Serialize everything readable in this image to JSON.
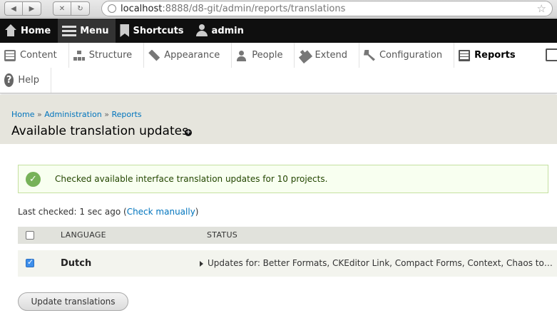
{
  "browser": {
    "url_host": "localhost",
    "url_path": ":8888/d8-git/admin/reports/translations"
  },
  "toolbar": {
    "home": "Home",
    "menu": "Menu",
    "shortcuts": "Shortcuts",
    "user": "admin"
  },
  "tray": {
    "items": [
      {
        "label": "Content",
        "icon": "content-icon"
      },
      {
        "label": "Structure",
        "icon": "structure-icon"
      },
      {
        "label": "Appearance",
        "icon": "appearance-icon"
      },
      {
        "label": "People",
        "icon": "people-icon"
      },
      {
        "label": "Extend",
        "icon": "extend-icon"
      },
      {
        "label": "Configuration",
        "icon": "config-icon"
      },
      {
        "label": "Reports",
        "icon": "reports-icon"
      }
    ],
    "help": "Help"
  },
  "breadcrumb": {
    "home": "Home",
    "sep": "»",
    "administration": "Administration",
    "reports": "Reports"
  },
  "page_title": "Available translation updates",
  "status_message": "Checked available interface translation updates for 10 projects.",
  "last_checked": {
    "prefix": "Last checked: 1 sec ago (",
    "link": "Check manually",
    "suffix": ")"
  },
  "table": {
    "headers": {
      "language": "LANGUAGE",
      "status": "STATUS"
    },
    "rows": [
      {
        "language": "Dutch",
        "status": "Updates for: Better Formats, CKEditor Link, Compact Forms, Context, Chaos tools, Delt…",
        "checked": true
      }
    ]
  },
  "submit_label": "Update translations"
}
